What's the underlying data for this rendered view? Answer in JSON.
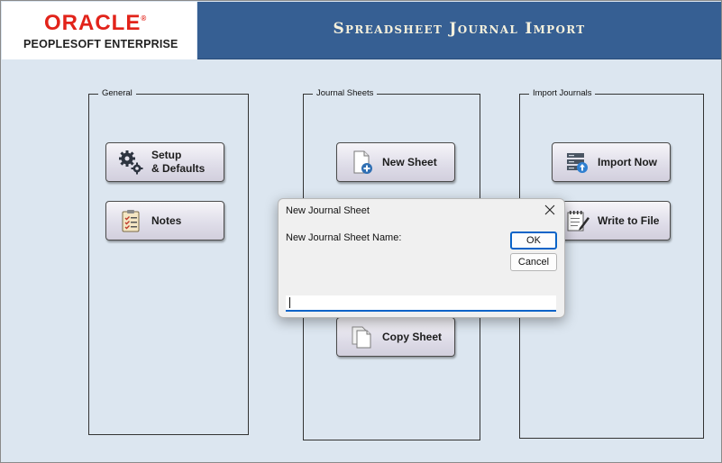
{
  "branding": {
    "oracle_word": "ORACLE",
    "registered_mark": "®",
    "product_line": "PEOPLESOFT ENTERPRISE"
  },
  "header": {
    "title": "Spreadsheet Journal Import"
  },
  "groups": {
    "general": {
      "label": "General",
      "buttons": {
        "setup": {
          "label": "Setup\n& Defaults",
          "icon": "gears-icon"
        },
        "notes": {
          "label": "Notes",
          "icon": "clipboard-checklist-icon"
        }
      }
    },
    "journal_sheets": {
      "label": "Journal Sheets",
      "buttons": {
        "new_sheet": {
          "label": "New Sheet",
          "icon": "new-document-icon"
        },
        "copy_sheet": {
          "label": "Copy Sheet",
          "icon": "copy-documents-icon"
        }
      }
    },
    "import_journals": {
      "label": "Import Journals",
      "buttons": {
        "import_now": {
          "label": "Import Now",
          "icon": "server-upload-icon"
        },
        "write_to_file": {
          "label": "Write to File",
          "icon": "notepad-pen-icon"
        }
      }
    }
  },
  "dialog": {
    "title": "New Journal Sheet",
    "prompt": "New Journal Sheet Name:",
    "ok_label": "OK",
    "cancel_label": "Cancel",
    "input_value": ""
  },
  "colors": {
    "background": "#dce6f0",
    "header_bar": "#365f93",
    "oracle_red": "#e2231a",
    "focus_blue": "#0a64c8"
  }
}
